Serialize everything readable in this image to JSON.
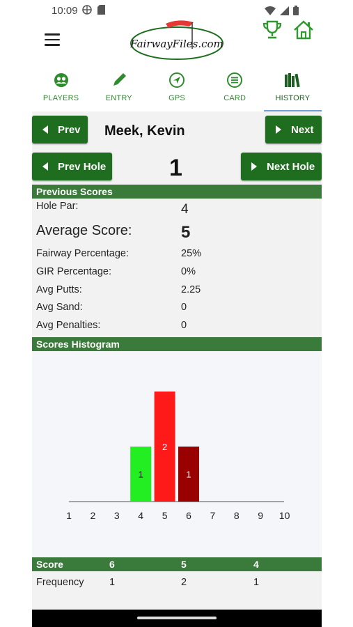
{
  "status": {
    "time": "10:09"
  },
  "header": {
    "logo_text": "FairwayFiles.com"
  },
  "tabs": [
    {
      "label": "PLAYERS",
      "icon": "players-icon"
    },
    {
      "label": "ENTRY",
      "icon": "pencil-icon"
    },
    {
      "label": "GPS",
      "icon": "navigation-icon"
    },
    {
      "label": "CARD",
      "icon": "list-icon"
    },
    {
      "label": "HISTORY",
      "icon": "books-icon",
      "active": true
    }
  ],
  "nav": {
    "prev_label": "Prev",
    "next_label": "Next",
    "player_name": "Meek, Kevin",
    "prev_hole_label": "Prev Hole",
    "next_hole_label": "Next Hole",
    "hole_number": "1"
  },
  "previous_scores": {
    "title": "Previous Scores",
    "hole_par_label": "Hole Par:",
    "hole_par_value": "4",
    "avg_score_label": "Average Score:",
    "avg_score_value": "5",
    "stats": [
      {
        "label": "Fairway Percentage:",
        "value": "25%"
      },
      {
        "label": "GIR Percentage:",
        "value": "0%"
      },
      {
        "label": "Avg Putts:",
        "value": "2.25"
      },
      {
        "label": "Avg Sand:",
        "value": "0"
      },
      {
        "label": "Avg Penalties:",
        "value": "0"
      }
    ]
  },
  "histogram_title": "Scores Histogram",
  "chart_data": {
    "type": "bar",
    "categories": [
      "1",
      "2",
      "3",
      "4",
      "5",
      "6",
      "7",
      "8",
      "9",
      "10"
    ],
    "values": [
      0,
      0,
      0,
      1,
      2,
      1,
      0,
      0,
      0,
      0
    ],
    "bar_colors": {
      "4": "#22ee22",
      "5": "#ff1a1a",
      "6": "#990000"
    },
    "data_labels": {
      "4": "1",
      "5": "2",
      "6": "1"
    },
    "ylim": [
      0,
      2
    ]
  },
  "score_table": {
    "header_label": "Score",
    "row_label": "Frequency",
    "scores": [
      "6",
      "5",
      "4"
    ],
    "frequencies": [
      "1",
      "2",
      "1"
    ]
  },
  "colors": {
    "accent_green": "#1f6e1f",
    "section_green": "#3a7a3a",
    "tab_green": "#2e8b2e"
  }
}
